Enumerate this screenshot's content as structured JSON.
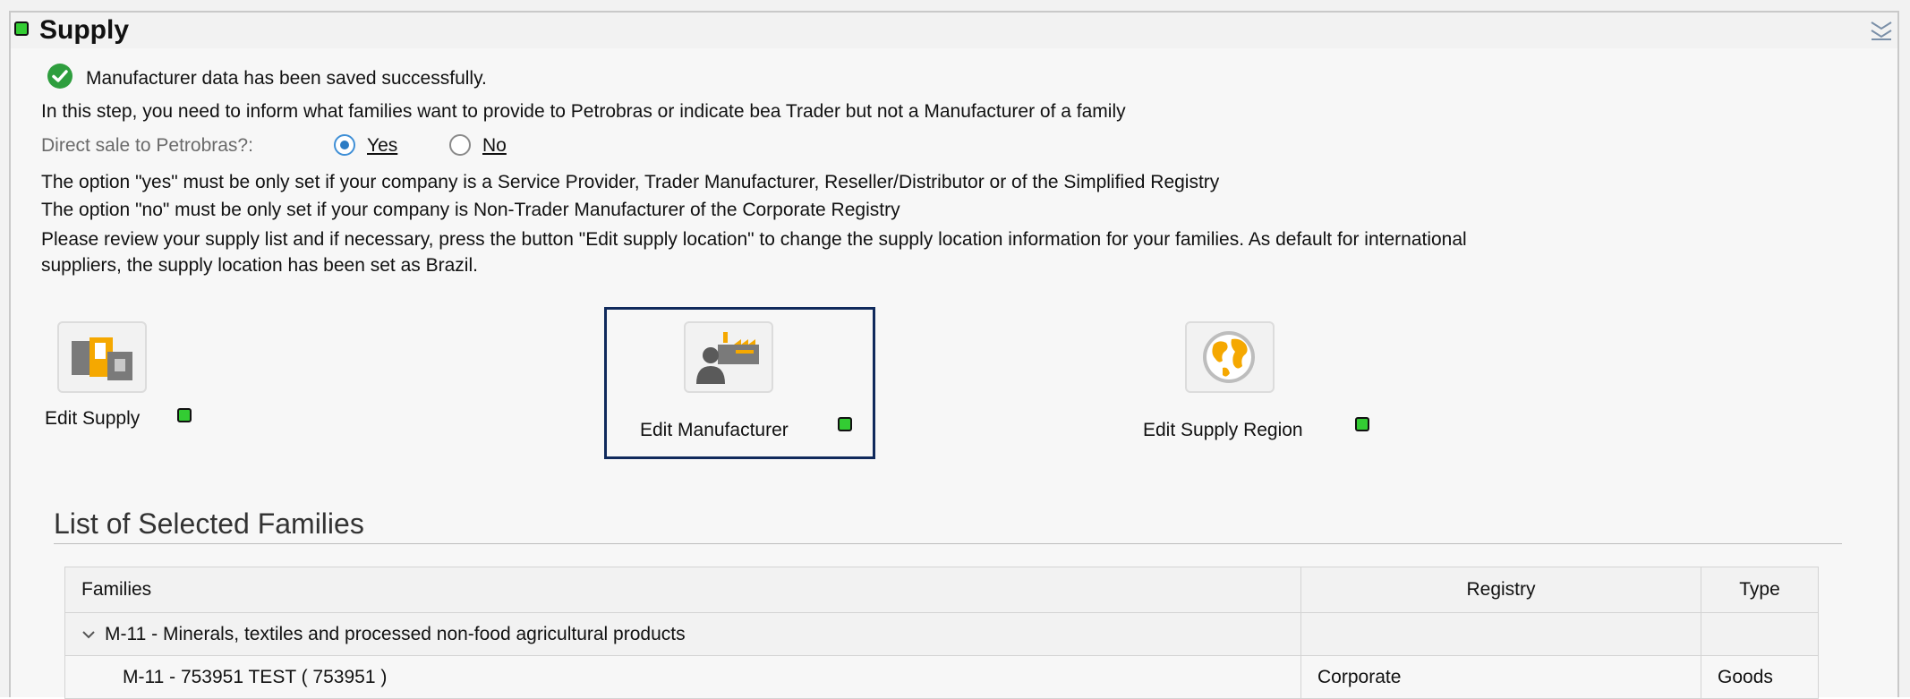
{
  "header": {
    "title": "Supply",
    "status_color": "#33cc33"
  },
  "messages": {
    "success": "Manufacturer data has been saved successfully.",
    "intro": "In this step, you need to inform what families want to provide to Petrobras or indicate bea Trader but not a Manufacturer of a family",
    "direct_sale_label": "Direct sale to Petrobras?:",
    "yes_option": "Yes",
    "no_option": "No",
    "selected_option": "Yes",
    "yes_note": "The option \"yes\" must be only set if your company is a Service Provider, Trader Manufacturer, Reseller/Distributor or of the Simplified Registry",
    "no_note": "The option \"no\" must be only set if your company is Non-Trader Manufacturer of the Corporate Registry",
    "review_note_1": "Please review your supply list and if necessary, press the button \"Edit supply location\" to change the supply location information for your families. As default for international",
    "review_note_2": "suppliers, the supply location has been set as Brazil."
  },
  "actions": [
    {
      "label": "Edit Supply",
      "icon": "supply-boxes-icon",
      "status_color": "#33cc33"
    },
    {
      "label": "Edit Manufacturer",
      "icon": "manufacturer-factory-icon",
      "status_color": "#33cc33"
    },
    {
      "label": "Edit Supply Region",
      "icon": "globe-icon",
      "status_color": "#33cc33"
    }
  ],
  "families_section": {
    "title": "List of Selected Families",
    "columns": [
      "Families",
      "Registry",
      "Type"
    ],
    "group_row": {
      "label": "M-11 - Minerals, textiles and processed non-food agricultural products",
      "registry": "",
      "type": ""
    },
    "item_row": {
      "label": "M-11 - 753951  TEST ( 753951 )",
      "registry": "Corporate",
      "type": "Goods"
    }
  }
}
